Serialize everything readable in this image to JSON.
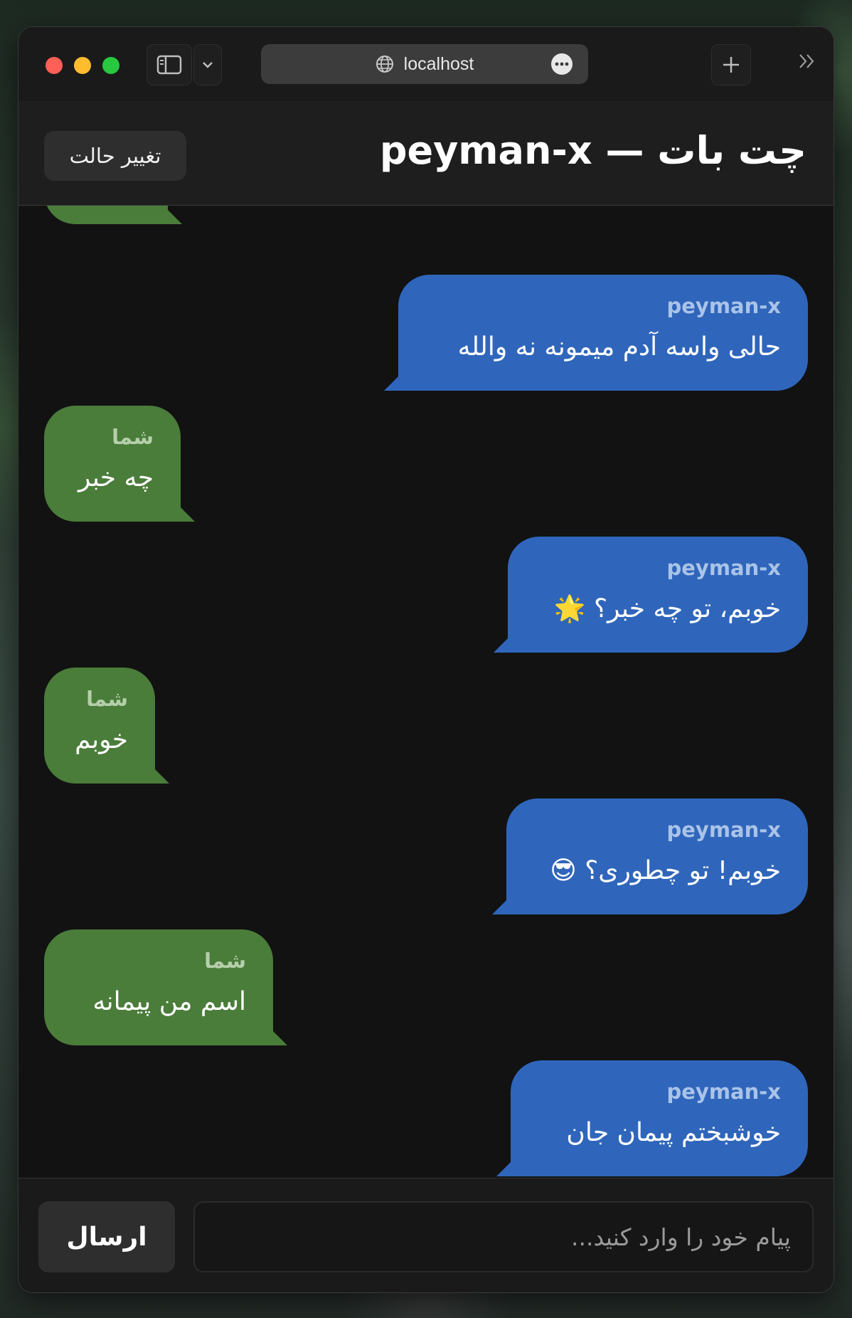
{
  "browser": {
    "address": "localhost"
  },
  "header": {
    "title": "چت بات — peyman-x",
    "toggle_label": "تغییر حالت"
  },
  "messages": [
    {
      "role": "bot",
      "sender": "peyman-x",
      "text": "حالی واسه آدم میمونه نه والله"
    },
    {
      "role": "user",
      "sender": "شما",
      "text": "چه خبر"
    },
    {
      "role": "bot",
      "sender": "peyman-x",
      "text": "خوبم، تو چه خبر؟ 🌟"
    },
    {
      "role": "user",
      "sender": "شما",
      "text": "خوبم"
    },
    {
      "role": "bot",
      "sender": "peyman-x",
      "text": "خوبم! تو چطوری؟ 😎"
    },
    {
      "role": "user",
      "sender": "شما",
      "text": "اسم من پیمانه"
    },
    {
      "role": "bot",
      "sender": "peyman-x",
      "text": "خوشبختم پیمان جان"
    }
  ],
  "composer": {
    "placeholder": "پیام خود را وارد کنید...",
    "value": "",
    "send_label": "ارسال"
  },
  "colors": {
    "bot_bubble": "#2f66bb",
    "user_bubble": "#4a7c3a",
    "background": "#121212"
  },
  "icons": [
    "sidebar-icon",
    "chevron-down-icon",
    "globe-icon",
    "more-icon",
    "plus-icon",
    "double-chevron-right-icon"
  ]
}
